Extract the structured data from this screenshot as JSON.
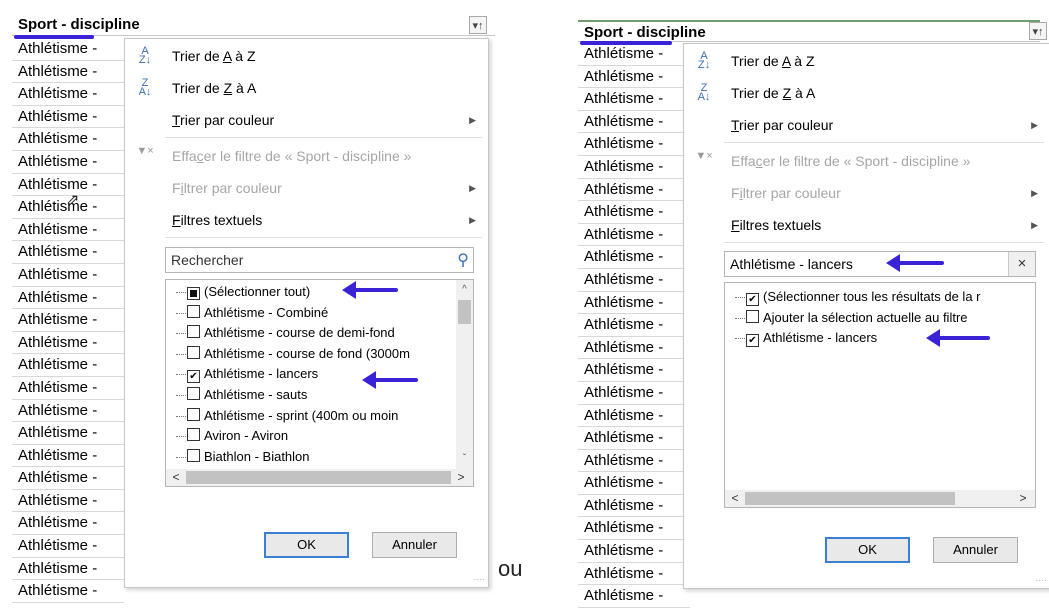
{
  "header": "Sport - discipline",
  "filter_icon": "filter-dropdown-icon",
  "row_text": "Athlétisme -",
  "left_rows": 25,
  "right_rows": 25,
  "menu": {
    "sort_az": {
      "pre": "Trier de ",
      "a": "A",
      "mid": " à Z"
    },
    "sort_za": {
      "pre": "Trier de ",
      "z": "Z",
      "mid": " à A"
    },
    "sort_color": {
      "u": "T",
      "rest": "rier par couleur"
    },
    "clear_filter": {
      "pre": "Effa",
      "u": "c",
      "rest": "er le filtre de « Sport - discipline »"
    },
    "filter_color": {
      "pre": "F",
      "u": "i",
      "rest": "ltrer par couleur"
    },
    "text_filters": {
      "u": "F",
      "rest": "iltres textuels"
    }
  },
  "left": {
    "search_placeholder": "Rechercher",
    "items": [
      {
        "label": "(Sélectionner tout)",
        "state": "partial"
      },
      {
        "label": "Athlétisme - Combiné",
        "state": "unchecked"
      },
      {
        "label": "Athlétisme - course de demi-fond",
        "state": "unchecked"
      },
      {
        "label": "Athlétisme - course de fond (3000m",
        "state": "unchecked"
      },
      {
        "label": "Athlétisme - lancers",
        "state": "checked"
      },
      {
        "label": "Athlétisme - sauts",
        "state": "unchecked"
      },
      {
        "label": "Athlétisme - sprint (400m ou moin",
        "state": "unchecked"
      },
      {
        "label": "Aviron - Aviron",
        "state": "unchecked"
      },
      {
        "label": "Biathlon - Biathlon",
        "state": "unchecked"
      }
    ]
  },
  "right": {
    "search_value": "Athlétisme - lancers",
    "items": [
      {
        "label": "(Sélectionner tous les résultats de la r",
        "state": "checked"
      },
      {
        "label": "Ajouter la sélection actuelle au filtre",
        "state": "unchecked"
      },
      {
        "label": "Athlétisme - lancers",
        "state": "checked"
      }
    ]
  },
  "buttons": {
    "ok": "OK",
    "cancel": "Annuler"
  },
  "separator_text": "ou",
  "accent_color": "#3a22d6"
}
